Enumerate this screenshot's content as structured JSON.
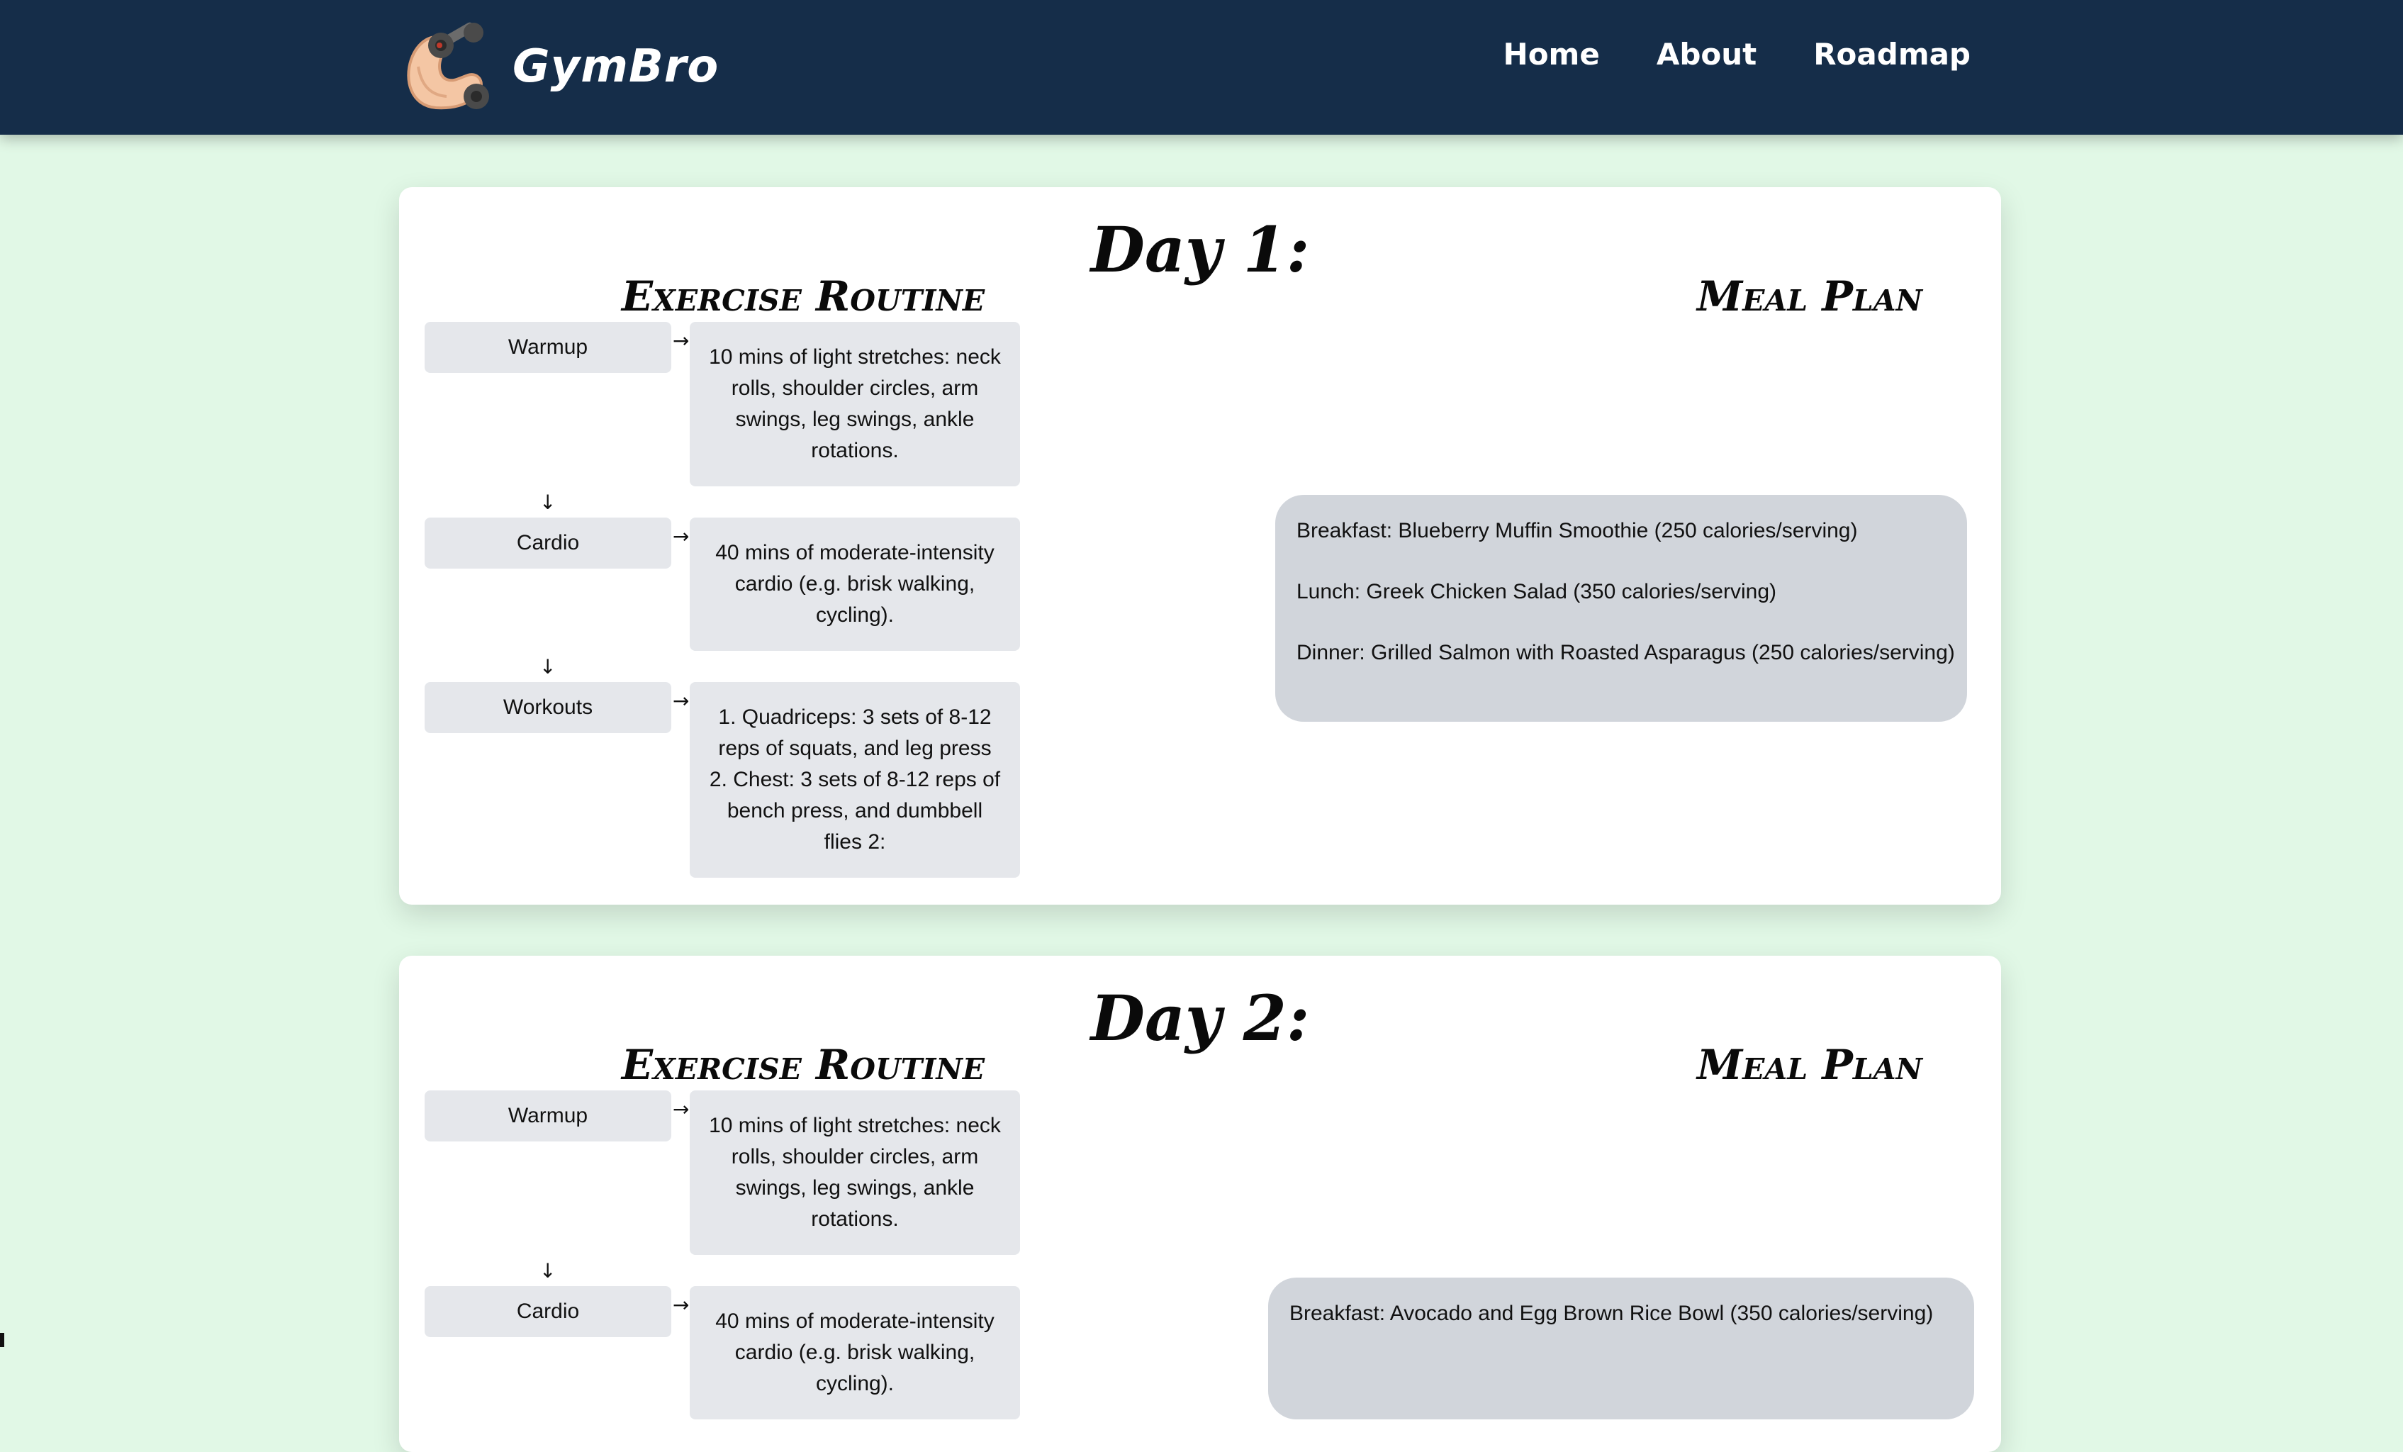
{
  "nav": {
    "brand": "GymBro",
    "links": [
      "Home",
      "About",
      "Roadmap"
    ]
  },
  "days": [
    {
      "title": "Day 1:",
      "exercise_title": "Exercise Routine",
      "meal_title": "Meal Plan",
      "steps": [
        {
          "label": "Warmup",
          "detail": "10 mins of light stretches: neck rolls, shoulder circles, arm swings, leg swings, ankle rotations."
        },
        {
          "label": "Cardio",
          "detail": "40 mins of moderate-intensity cardio (e.g. brisk walking, cycling)."
        },
        {
          "label": "Workouts",
          "detail": "1. Quadriceps: 3 sets of 8-12 reps of squats, and leg press 2. Chest: 3 sets of 8-12 reps of bench press, and dumbbell flies 2:"
        }
      ],
      "meals": [
        "Breakfast: Blueberry Muffin Smoothie (250 calories/serving)",
        "Lunch: Greek Chicken Salad (350 calories/serving)",
        "Dinner: Grilled Salmon with Roasted Asparagus (250 calories/serving)"
      ]
    },
    {
      "title": "Day 2:",
      "exercise_title": "Exercise Routine",
      "meal_title": "Meal Plan",
      "steps": [
        {
          "label": "Warmup",
          "detail": "10 mins of light stretches: neck rolls, shoulder circles, arm swings, leg swings, ankle rotations."
        },
        {
          "label": "Cardio",
          "detail": "40 mins of moderate-intensity cardio (e.g. brisk walking, cycling)."
        }
      ],
      "meals": [
        "Breakfast: Avocado and Egg Brown Rice Bowl (350 calories/serving)"
      ]
    }
  ],
  "arrows": {
    "right": "→",
    "down": "↓"
  }
}
